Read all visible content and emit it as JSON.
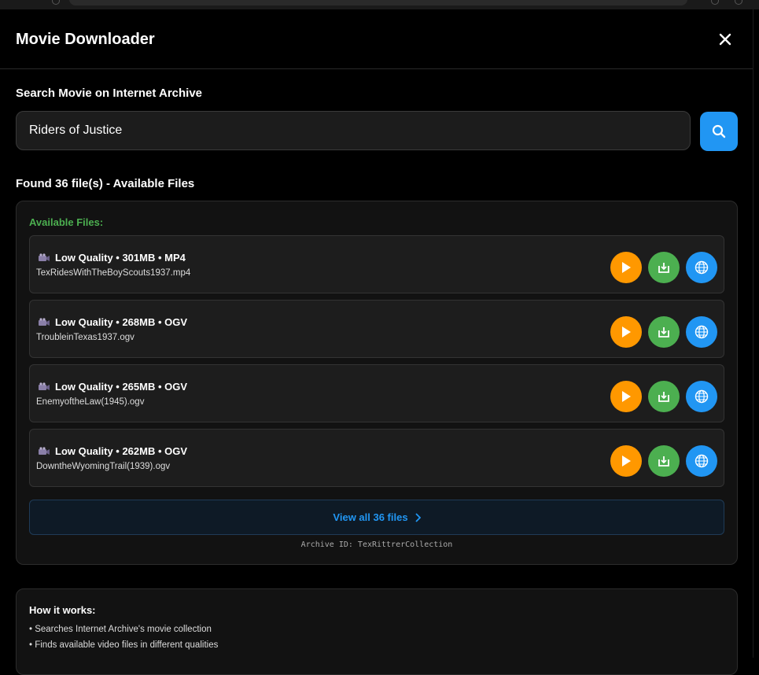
{
  "app": {
    "title": "Movie Downloader"
  },
  "search": {
    "label": "Search Movie on Internet Archive",
    "value": "Riders of Justice",
    "placeholder": ""
  },
  "results": {
    "heading": "Found 36 file(s) - Available Files",
    "panel_label": "Available Files:",
    "files": [
      {
        "title": "Low Quality • 301MB • MP4",
        "filename": "TexRidesWithTheBoyScouts1937.mp4"
      },
      {
        "title": "Low Quality • 268MB • OGV",
        "filename": "TroubleinTexas1937.ogv"
      },
      {
        "title": "Low Quality • 265MB • OGV",
        "filename": "EnemyoftheLaw(1945).ogv"
      },
      {
        "title": "Low Quality • 262MB • OGV",
        "filename": "DowntheWyomingTrail(1939).ogv"
      }
    ],
    "view_all_label": "View all 36 files",
    "archive_id": "Archive ID: TexRittrerCollection"
  },
  "how_it_works": {
    "title": "How it works:",
    "items": [
      "• Searches Internet Archive's movie collection",
      "• Finds available video files in different qualities"
    ]
  },
  "colors": {
    "play": "#ff9800",
    "download": "#4caf50",
    "web": "#2196f3",
    "accent": "#2196f3"
  }
}
